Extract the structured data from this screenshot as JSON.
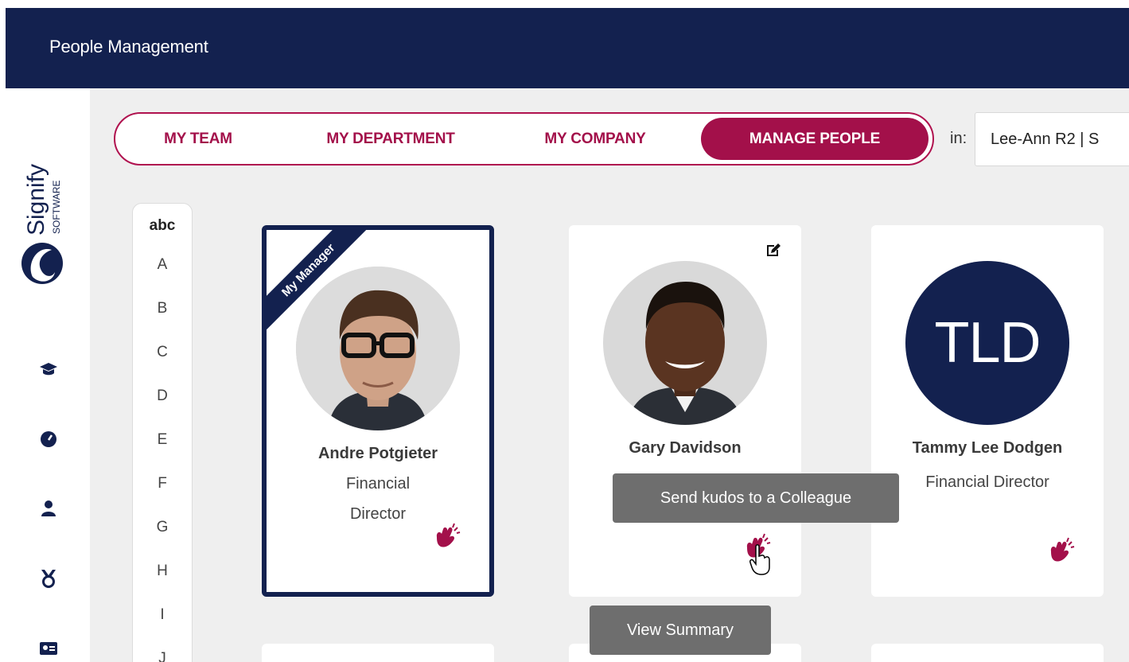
{
  "header": {
    "title": "People Management"
  },
  "sidebar": {
    "logo_text": "Signify",
    "logo_subtext": "SOFTWARE",
    "icons": [
      "graduation-cap-icon",
      "gauge-icon",
      "user-icon",
      "medal-icon",
      "id-card-icon"
    ]
  },
  "tabs": [
    {
      "label": "MY TEAM",
      "active": false
    },
    {
      "label": "MY DEPARTMENT",
      "active": false
    },
    {
      "label": "MY COMPANY",
      "active": false
    },
    {
      "label": "MANAGE PEOPLE",
      "active": true
    }
  ],
  "filter": {
    "in_label": "in:",
    "value": "Lee-Ann R2 | S"
  },
  "alphabet": [
    "abc",
    "A",
    "B",
    "C",
    "D",
    "E",
    "F",
    "G",
    "H",
    "I",
    "J"
  ],
  "people": [
    {
      "name": "Andre Potgieter",
      "role_line1": "Financial",
      "role_line2": "Director",
      "badge": "My Manager",
      "avatar": "photo"
    },
    {
      "name": "Gary Davidson",
      "role": "",
      "avatar": "photo",
      "editable": true
    },
    {
      "name": "Tammy Lee Dodgen",
      "role": "Financial Director",
      "initials": "TLD",
      "avatar": "initials"
    }
  ],
  "tooltips": {
    "kudos": "Send kudos to a Colleague",
    "summary": "View Summary"
  },
  "colors": {
    "navy": "#13214f",
    "accent": "#a3104a",
    "background": "#efefef",
    "tooltip": "#6e6e6e"
  }
}
